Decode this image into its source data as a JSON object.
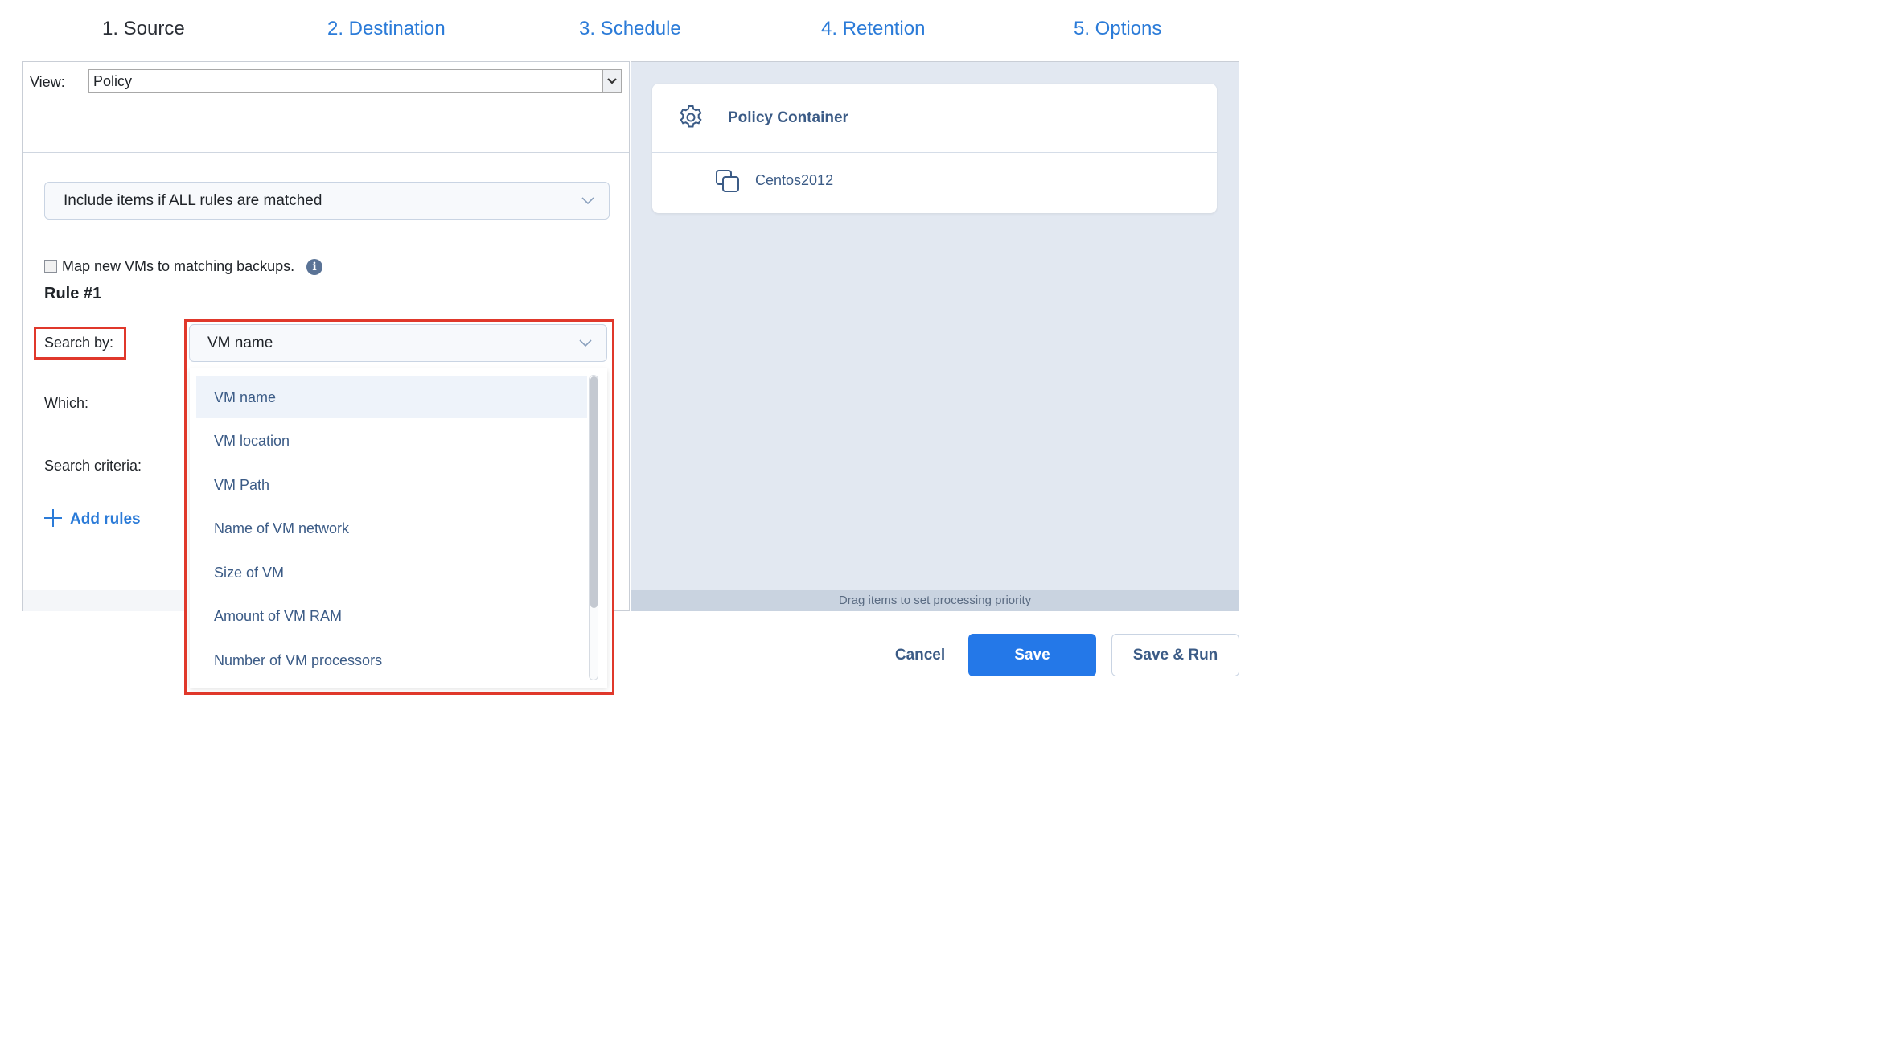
{
  "steps": [
    {
      "label": "1. Source"
    },
    {
      "label": "2. Destination"
    },
    {
      "label": "3. Schedule"
    },
    {
      "label": "4. Retention"
    },
    {
      "label": "5. Options"
    }
  ],
  "view": {
    "label": "View:",
    "value": "Policy"
  },
  "rule_mode": {
    "value": "Include items if ALL rules are matched"
  },
  "map_vms": {
    "label": "Map new VMs to matching backups.",
    "checked": false
  },
  "rule": {
    "title": "Rule #1",
    "search_by_label": "Search by:",
    "which_label": "Which:",
    "criteria_label": "Search criteria:",
    "search_by_value": "VM name"
  },
  "dropdown_options": [
    "VM name",
    "VM location",
    "VM Path",
    "Name of VM network",
    "Size of VM",
    "Amount of VM RAM",
    "Number of VM processors"
  ],
  "add_rules": "Add rules",
  "policy_container": {
    "title": "Policy Container",
    "item": "Centos2012"
  },
  "drag_hint": "Drag items to set processing priority",
  "buttons": {
    "cancel": "Cancel",
    "save": "Save",
    "save_run": "Save & Run"
  },
  "colors": {
    "accent": "#2478e8",
    "link": "#2b7bd8",
    "highlight": "#e0382b",
    "panel_bg": "#e2e8f1"
  }
}
